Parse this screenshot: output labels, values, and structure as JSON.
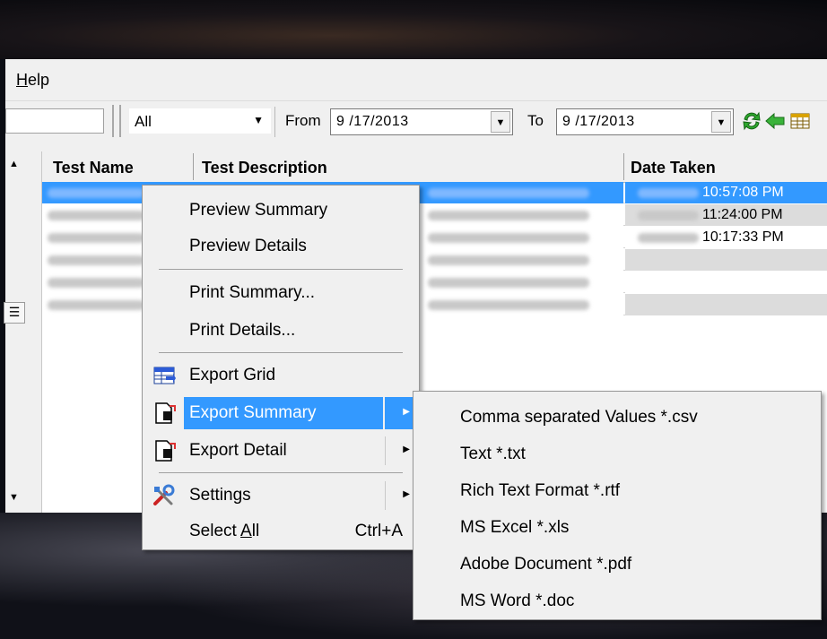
{
  "menubar": {
    "help_prefix": "H",
    "help_rest": "elp"
  },
  "toolbar": {
    "filter_value": "All",
    "from_label": "From",
    "from_date": "9 /17/2013",
    "to_label": "To",
    "to_date": "9 /17/2013"
  },
  "grid": {
    "columns": [
      "Test Name",
      "Test Description",
      "Date Taken"
    ],
    "rows": [
      {
        "time": "10:57:08 PM",
        "selected": true
      },
      {
        "time": "11:24:00 PM",
        "selected": false
      },
      {
        "time": "10:17:33 PM",
        "selected": false
      },
      {
        "time": "",
        "selected": false
      },
      {
        "time": "",
        "selected": false
      },
      {
        "time": "",
        "selected": false
      }
    ]
  },
  "context_menu": {
    "preview_summary": "Preview Summary",
    "preview_details": "Preview Details",
    "print_summary": "Print Summary...",
    "print_details": "Print Details...",
    "export_grid": "Export Grid",
    "export_summary": "Export Summary",
    "export_detail": "Export Detail",
    "settings": "Settings",
    "select_all_prefix": "Select ",
    "select_all_accel": "A",
    "select_all_rest": "ll",
    "select_all_shortcut": "Ctrl+A"
  },
  "export_submenu": {
    "items": [
      "Comma separated Values *.csv",
      "Text *.txt",
      "Rich Text Format *.rtf",
      "MS Excel *.xls",
      "Adobe Document *.pdf",
      "MS Word *.doc"
    ]
  },
  "icons": {
    "refresh": "refresh-icon",
    "back": "back-arrow-icon",
    "grid": "grid-icon",
    "settings": "tools-icon"
  },
  "colors": {
    "highlight": "#3399ff",
    "refresh_green": "#2ea82e"
  }
}
